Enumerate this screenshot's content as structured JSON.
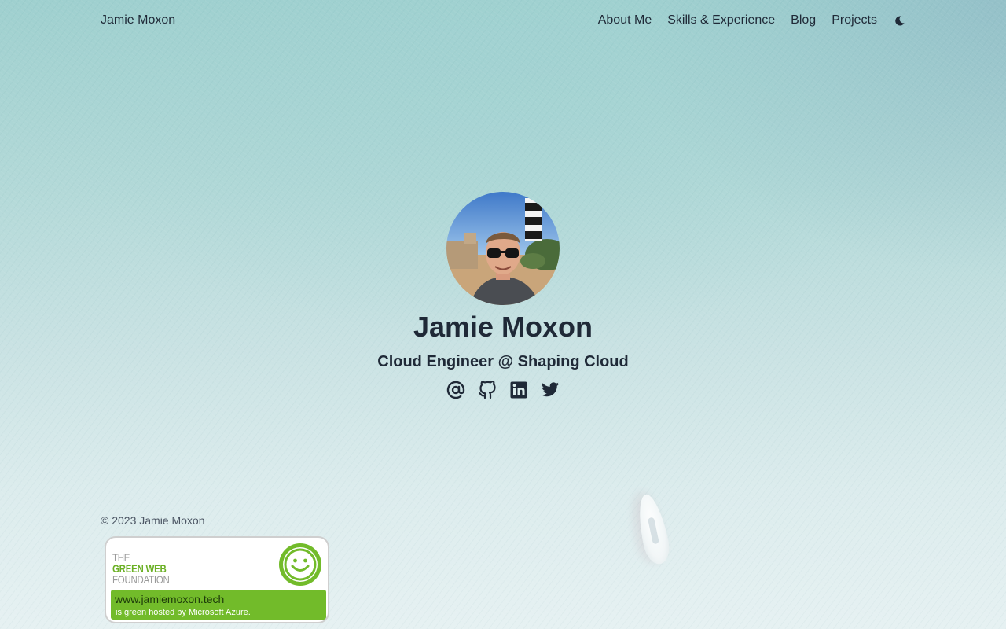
{
  "header": {
    "site_title": "Jamie Moxon",
    "nav": [
      {
        "label": "About Me"
      },
      {
        "label": "Skills & Experience"
      },
      {
        "label": "Blog"
      },
      {
        "label": "Projects"
      }
    ],
    "theme_toggle_icon": "moon-icon"
  },
  "hero": {
    "avatar_icon": "profile-photo",
    "name": "Jamie Moxon",
    "tagline": "Cloud Engineer @ Shaping Cloud",
    "socials": [
      {
        "icon": "at-sign-icon"
      },
      {
        "icon": "github-icon"
      },
      {
        "icon": "linkedin-icon"
      },
      {
        "icon": "twitter-icon"
      }
    ]
  },
  "footer": {
    "copyright": "© 2023 Jamie Moxon",
    "badge": {
      "org_line1": "THE",
      "org_line2": "GREEN WEB",
      "org_line3": "FOUNDATION",
      "domain": "www.jamiemoxon.tech",
      "hosted_text": "is green hosted by Microsoft Azure.",
      "accent_color": "#72bb2a"
    }
  },
  "colors": {
    "text": "#1f2937",
    "muted": "#4b5563",
    "background_top": "#9fd0cf",
    "background_bottom": "#e6f1f2"
  }
}
